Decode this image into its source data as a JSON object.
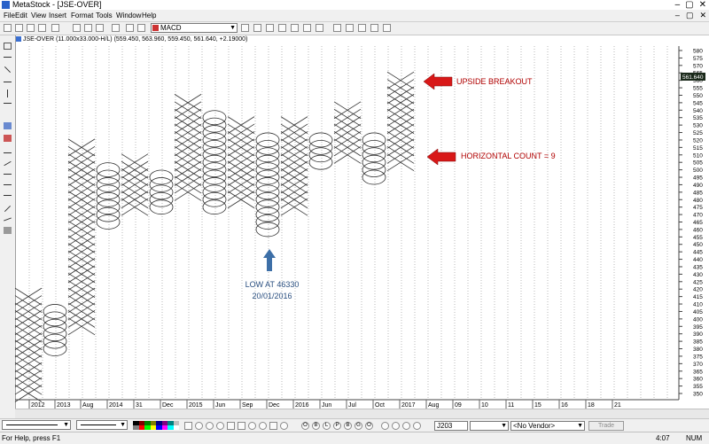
{
  "window": {
    "title": "MetaStock - [JSE-OVER]",
    "controls": [
      "‒",
      "▢",
      "✕"
    ]
  },
  "menu": {
    "items": [
      "File",
      "Edit",
      "View",
      "Insert",
      "Format",
      "Tools",
      "Window",
      "Help"
    ],
    "mdi_controls": [
      "‒",
      "▢",
      "✕"
    ]
  },
  "toolbar": {
    "indicator_select": "MACD"
  },
  "chart": {
    "header": "JSE-OVER (11.000x33.000-H/L) (559.450, 563.960, 559.450, 561.640, +2.19000)",
    "price_tag": "561.640",
    "y_ticks": [
      "580",
      "575",
      "570",
      "565",
      "560",
      "555",
      "550",
      "545",
      "540",
      "535",
      "530",
      "525",
      "520",
      "515",
      "510",
      "505",
      "500",
      "495",
      "490",
      "485",
      "480",
      "475",
      "470",
      "465",
      "460",
      "455",
      "450",
      "445",
      "440",
      "435",
      "430",
      "425",
      "420",
      "415",
      "410",
      "405",
      "400",
      "395",
      "390",
      "385",
      "380",
      "375",
      "370",
      "365",
      "360",
      "355",
      "350"
    ],
    "x_labels": [
      "2012",
      "2013",
      "Aug",
      "2014",
      "31",
      "Dec",
      "2015",
      "Jun",
      "Sep",
      "Dec",
      "2016",
      "Jun",
      "Jul",
      "Oct",
      "2017",
      "Aug",
      "09",
      "10",
      "11",
      "15",
      "16",
      "18",
      "21"
    ],
    "annotations": {
      "breakout": "UPSIDE BREAKOUT",
      "count": "HORIZONTAL COUNT = 9",
      "low_line1": "LOW AT 46330",
      "low_line2": "20/01/2016"
    },
    "colors": {
      "x_mark": "#333333",
      "o_mark": "#333333",
      "red_arrow": "#d81818",
      "blue_arrow": "#3d6fa7",
      "annotation_red": "#b00000",
      "annotation_blue": "#2a4f80"
    },
    "columns": [
      {
        "type": "X",
        "from": 350,
        "to": 415
      },
      {
        "type": "O",
        "from": 380,
        "to": 405
      },
      {
        "type": "X",
        "from": 395,
        "to": 515
      },
      {
        "type": "O",
        "from": 465,
        "to": 500
      },
      {
        "type": "X",
        "from": 475,
        "to": 505
      },
      {
        "type": "O",
        "from": 475,
        "to": 495
      },
      {
        "type": "X",
        "from": 485,
        "to": 545
      },
      {
        "type": "O",
        "from": 475,
        "to": 535
      },
      {
        "type": "X",
        "from": 480,
        "to": 530
      },
      {
        "type": "O",
        "from": 460,
        "to": 520
      },
      {
        "type": "X",
        "from": 475,
        "to": 530
      },
      {
        "type": "O",
        "from": 505,
        "to": 520
      },
      {
        "type": "X",
        "from": 510,
        "to": 540
      },
      {
        "type": "O",
        "from": 495,
        "to": 520
      },
      {
        "type": "X",
        "from": 505,
        "to": 560
      }
    ]
  },
  "bottom_toolbar": {
    "symbol": "J203",
    "vendor": "<No Vendor>",
    "trade": "Trade",
    "circle_letters": [
      "O",
      "B",
      "L",
      "P",
      "B",
      "G",
      "O"
    ]
  },
  "status": {
    "left": "For Help, press F1",
    "time": "4:07",
    "num": "NUM"
  }
}
